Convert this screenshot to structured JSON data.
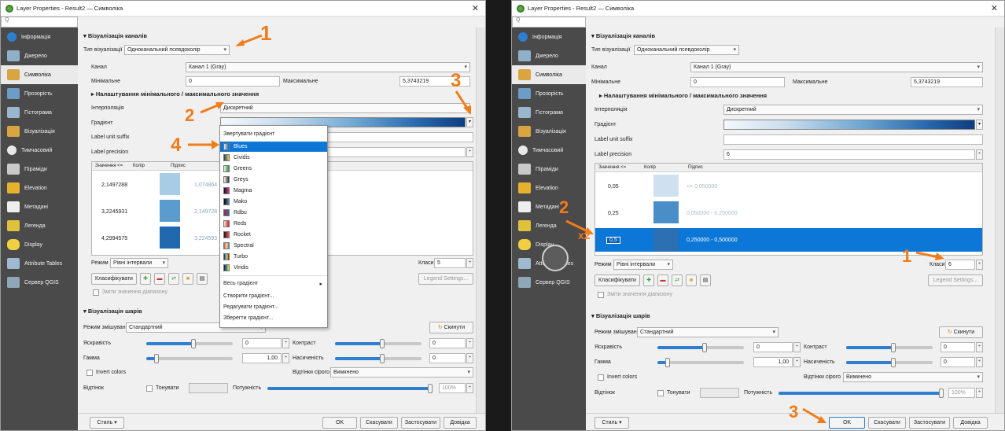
{
  "window_title": "Layer Properties - Result2 — Символіка",
  "search_placeholder": "Q",
  "sidebar_left": [
    "Інформація",
    "Джерело",
    "Символіка",
    "Прозорість",
    "Гістограма",
    "Візуалізація",
    "Тимчасовий",
    "Піраміди",
    "Elevation",
    "Метадані",
    "Легенда",
    "Display",
    "Attribute Tables",
    "Сервер QGIS"
  ],
  "sidebar_right": [
    "Інформація",
    "Джерело",
    "Символіка",
    "Прозорість",
    "Гістограма",
    "Візуалізація",
    "Тимчасовий",
    "Піраміди",
    "Elevation",
    "Метадані",
    "Легенда",
    "Display",
    "Attribute Tables",
    "Сервер QGIS"
  ],
  "band": {
    "section_title": "Візуалізація каналів",
    "render_type_label": "Тип візуалізації",
    "render_type_value": "Одноканальний псевдоколір",
    "channel_label": "Канал",
    "channel_value_left": "Канал 1 (Gray)",
    "channel_value_right": "Канал 1 (Gray)",
    "min_label": "Мінімальне",
    "min_value": "0",
    "max_label": "Максимальне",
    "max_value": "5,3743219",
    "minmax_section": "Налаштування мінімального / максимального значення",
    "interp_label": "Інтерполяція",
    "interp_value": "Дискретний",
    "gradient_label": "Градієнт",
    "unit_suffix_label": "Label unit suffix",
    "precision_label": "Label precision",
    "precision_value": "6",
    "table_headers": [
      "Значення <=",
      "Колір",
      "Підпис"
    ],
    "mode_label": "Режим",
    "mode_value": "Рівні інтервали",
    "classes_label": "Класи",
    "classes_left": "5",
    "classes_right": "6",
    "classify_button": "Класифікувати",
    "legend_settings": "Legend Settings...",
    "clip_label": "Зміти значення діапазону"
  },
  "table_left": [
    {
      "value": "2,1497288",
      "color": "#a9cce6",
      "label": "1,074864 - 2,149728"
    },
    {
      "value": "3,2245931",
      "color": "#5b9ccf",
      "label": "2,149728 - 3,224593"
    },
    {
      "value": "4,2994575",
      "color": "#2268ae",
      "label": "3,224593 - 4,299457"
    }
  ],
  "table_right": [
    {
      "value": "0,05",
      "color": "#cfe1f1",
      "label": "<= 0,050000"
    },
    {
      "value": "0,25",
      "color": "#4a8ec8",
      "label": "0,050000 - 0,250000"
    },
    {
      "value": "0,5",
      "color": "#2d6fb3",
      "label": "0,250000 - 0,500000"
    }
  ],
  "popup": {
    "items": [
      {
        "label": "Звертувати градієнт",
        "color": ""
      },
      {
        "label": "Blues",
        "color": "#1f5fa8"
      },
      {
        "label": "Cividis",
        "color": "#6b6a55"
      },
      {
        "label": "Greens",
        "color": "#2e8b3e"
      },
      {
        "label": "Greys",
        "color": "#444444"
      },
      {
        "label": "Magma",
        "color": "#8c2466"
      },
      {
        "label": "Mako",
        "color": "#2b3f6b"
      },
      {
        "label": "Rdbu",
        "color": "#b2243a"
      },
      {
        "label": "Reds",
        "color": "#c52222"
      },
      {
        "label": "Rocket",
        "color": "#a01c3e"
      },
      {
        "label": "Spectral",
        "color": "#e06a38"
      },
      {
        "label": "Turbo",
        "color": "#d7432a"
      },
      {
        "label": "Viridis",
        "color": "#2d7f6f"
      },
      {
        "label": "Весь градієнт",
        "color": ""
      },
      {
        "label": "Створити градієнт...",
        "color": ""
      },
      {
        "label": "Редагувати градієнт...",
        "color": ""
      },
      {
        "label": "Зберегти градієнт...",
        "color": ""
      }
    ],
    "selected_index": 1
  },
  "color": {
    "section_title": "Візуалізація шарів",
    "blend_label": "Режим змішування",
    "blend_value": "Стандартний",
    "reset_button": "Скинути",
    "brightness_label": "Яскравість",
    "brightness_value": "0",
    "contrast_label": "Контраст",
    "contrast_value": "0",
    "gamma_label": "Гамма",
    "gamma_value": "1,00",
    "saturation_label": "Насиченість",
    "saturation_value": "0",
    "invert_label": "Invert colors",
    "grayscale_label": "Відтінки сірого",
    "grayscale_value": "Вимкнено",
    "hue_label": "Відтінок",
    "tint_label": "Тонувати",
    "strength_label": "Потужність",
    "strength_value": "100%"
  },
  "buttons": {
    "style": "Стиль",
    "ok": "OK",
    "cancel": "Скасувати",
    "apply": "Застосувати",
    "help": "Довідка"
  },
  "annotations_left": [
    "1",
    "2",
    "3",
    "4"
  ],
  "annotations_right": [
    "2",
    "x2",
    "1",
    "3"
  ],
  "accent": "#f07c1c",
  "select_blue": "#0c77d6"
}
